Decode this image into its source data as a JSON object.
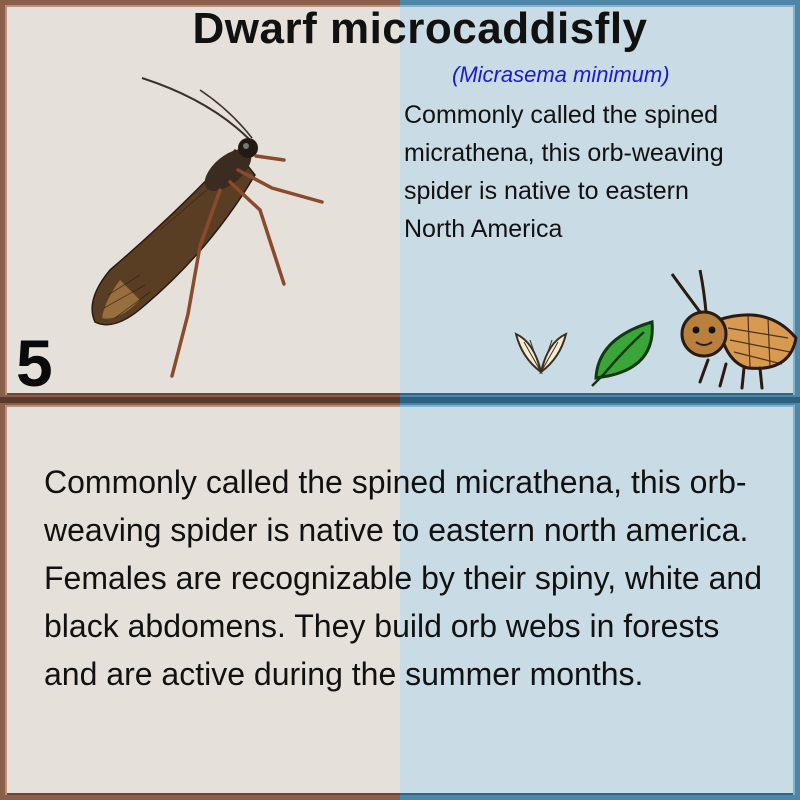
{
  "card": {
    "title": "Dwarf microcaddisfly",
    "scientific_name": "(Micrasema minimum)",
    "short_description": "Commonly called the spined micrathena, this orb-weaving spider is native to eastern North America",
    "number": "5",
    "long_description": "Commonly called the spined micrathena, this orb-weaving spider is native to eastern north america. Females are recognizable by their spiny, white and black abdomens. They build orb webs in forests and are active during the summer months."
  },
  "icons": [
    "wings-icon",
    "leaf-icon",
    "moth-cartoon-icon"
  ],
  "colors": {
    "left_frame": "#8a5e48",
    "right_frame": "#4e86a8",
    "scientific_name": "#1a1ad6",
    "leaf": "#3aa63a"
  }
}
